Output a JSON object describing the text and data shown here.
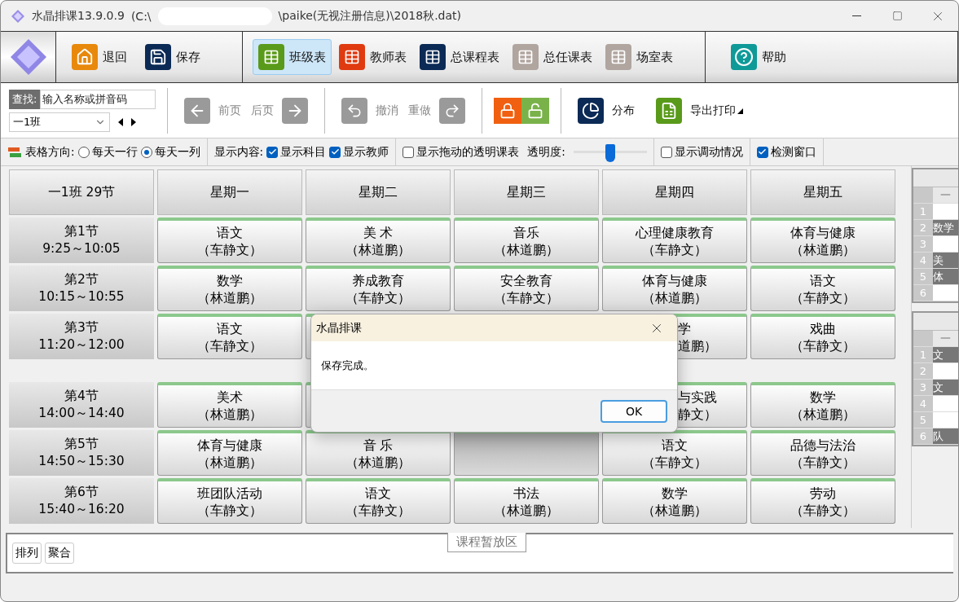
{
  "window": {
    "title": "水晶排课13.9.0.9",
    "path_start": "(C:\\",
    "path_end": "\\paike(无视注册信息)\\2018秋.dat)"
  },
  "main_toolbar": [
    {
      "label": "退回",
      "kind": "home",
      "color": "#e8890c",
      "selected": false
    },
    {
      "label": "保存",
      "kind": "save",
      "color": "#0b2a55",
      "selected": false
    },
    {
      "label": "班级表",
      "kind": "table",
      "color": "#5a9a1a",
      "selected": true
    },
    {
      "label": "教师表",
      "kind": "table",
      "color": "#e03a10",
      "selected": false
    },
    {
      "label": "总课程表",
      "kind": "table",
      "color": "#0b2a55",
      "selected": false
    },
    {
      "label": "总任课表",
      "kind": "table",
      "color": "#b0a59f",
      "selected": false
    },
    {
      "label": "场室表",
      "kind": "table",
      "color": "#b0a59f",
      "selected": false
    },
    {
      "label": "帮助",
      "kind": "help",
      "color": "#0f9a98",
      "selected": false
    }
  ],
  "search": {
    "label": "查找:",
    "placeholder": "输入名称或拼音码"
  },
  "class_select": {
    "value": "一1班"
  },
  "nav": [
    {
      "label": "前页",
      "kind": "prev",
      "disabled": true
    },
    {
      "label": "后页",
      "kind": "next",
      "disabled": true
    },
    {
      "label": "撤消",
      "kind": "undo",
      "disabled": true
    },
    {
      "label": "重做",
      "kind": "redo",
      "disabled": true
    }
  ],
  "tools": [
    {
      "label": "分布",
      "kind": "pie"
    },
    {
      "label": "导出打印",
      "kind": "excel",
      "menu": true
    }
  ],
  "options": {
    "orientation_label": "表格方向:",
    "orientations": [
      {
        "label": "每天一行",
        "selected": false
      },
      {
        "label": "每天一列",
        "selected": true
      }
    ],
    "content_label": "显示内容:",
    "content": [
      {
        "label": "显示科目",
        "checked": true
      },
      {
        "label": "显示教师",
        "checked": true
      }
    ],
    "transparent": {
      "label": "显示拖动的透明课表",
      "checked": false
    },
    "opacity_label": "透明度:",
    "opacity": {
      "level": 0.5
    },
    "show_changes": {
      "label": "显示调动情况",
      "checked": false
    },
    "detect_window": {
      "label": "检测窗口",
      "checked": true
    }
  },
  "timetable": {
    "corner": "一1班 29节",
    "days": [
      "星期一",
      "星期二",
      "星期三",
      "星期四",
      "星期五"
    ],
    "sessions": [
      {
        "periods": [
          {
            "label": "第1节",
            "time": "9:25～10:05",
            "cells": [
              {
                "kind": "normal",
                "subject": "语文",
                "teacher": "（车静文）"
              },
              {
                "kind": "normal",
                "subject": "美 术",
                "teacher": "（林道鹏）"
              },
              {
                "kind": "normal",
                "subject": "音乐",
                "teacher": "（林道鹏）"
              },
              {
                "kind": "normal",
                "subject": "心理健康教育",
                "teacher": "（车静文）"
              },
              {
                "kind": "normal",
                "subject": "体育与健康",
                "teacher": "（林道鹏）"
              }
            ]
          },
          {
            "label": "第2节",
            "time": "10:15～10:55",
            "cells": [
              {
                "kind": "normal",
                "subject": "数学",
                "teacher": "（林道鹏）"
              },
              {
                "kind": "normal",
                "subject": "养成教育",
                "teacher": "（车静文）"
              },
              {
                "kind": "normal",
                "subject": "安全教育",
                "teacher": "（车静文）"
              },
              {
                "kind": "normal",
                "subject": "体育与健康",
                "teacher": "（林道鹏）"
              },
              {
                "kind": "normal",
                "subject": "语文",
                "teacher": "（车静文）"
              }
            ]
          },
          {
            "label": "第3节",
            "time": "11:20～12:00",
            "cells": [
              {
                "kind": "normal",
                "subject": "语文",
                "teacher": "（车静文）"
              },
              {
                "kind": "hidden"
              },
              {
                "kind": "covered"
              },
              {
                "kind": "partial",
                "subject": "学",
                "teacher": "道鹏）"
              },
              {
                "kind": "normal",
                "subject": "戏曲",
                "teacher": "（车静文）"
              }
            ]
          }
        ]
      },
      {
        "periods": [
          {
            "label": "第4节",
            "time": "14:00～14:40",
            "cells": [
              {
                "kind": "normal",
                "subject": "美术",
                "teacher": "（林道鹏）"
              },
              {
                "kind": "hidden"
              },
              {
                "kind": "covered"
              },
              {
                "kind": "partial",
                "subject": "与实践",
                "teacher": "静文）"
              },
              {
                "kind": "normal",
                "subject": "数学",
                "teacher": "（林道鹏）"
              }
            ]
          },
          {
            "label": "第5节",
            "time": "14:50～15:30",
            "cells": [
              {
                "kind": "normal",
                "subject": "体育与健康",
                "teacher": "（林道鹏）"
              },
              {
                "kind": "normal",
                "subject": "音 乐",
                "teacher": "（林道鹏）"
              },
              {
                "kind": "empty"
              },
              {
                "kind": "normal",
                "subject": "语文",
                "teacher": "（车静文）"
              },
              {
                "kind": "normal",
                "subject": "品德与法治",
                "teacher": "（车静文）"
              }
            ]
          },
          {
            "label": "第6节",
            "time": "15:40～16:20",
            "cells": [
              {
                "kind": "normal",
                "subject": "班团队活动",
                "teacher": "（车静文）"
              },
              {
                "kind": "normal",
                "subject": "语文",
                "teacher": "（车静文）"
              },
              {
                "kind": "normal",
                "subject": "书法",
                "teacher": "（林道鹏）"
              },
              {
                "kind": "normal",
                "subject": "数学",
                "teacher": "（林道鹏）"
              },
              {
                "kind": "normal",
                "subject": "劳动",
                "teacher": "（车静文）"
              }
            ]
          }
        ]
      }
    ]
  },
  "side_panels": [
    {
      "header": "一",
      "rows": [
        {
          "num": "1"
        },
        {
          "num": "2",
          "text": "数学"
        },
        {
          "num": "3"
        },
        {
          "num": "4",
          "text": "美"
        },
        {
          "num": "5",
          "text": "体"
        },
        {
          "num": "6"
        }
      ]
    },
    {
      "header": "一",
      "rows": [
        {
          "num": "1",
          "text": "文"
        },
        {
          "num": "2"
        },
        {
          "num": "3",
          "text": "文"
        },
        {
          "num": "4"
        },
        {
          "num": "5"
        },
        {
          "num": "6",
          "text": "队"
        }
      ]
    }
  ],
  "holding_area": {
    "buttons": [
      "排列",
      "聚合"
    ],
    "label": "课程暂放区"
  },
  "dialog": {
    "title": "水晶排课",
    "message": "保存完成。",
    "button": "OK"
  }
}
